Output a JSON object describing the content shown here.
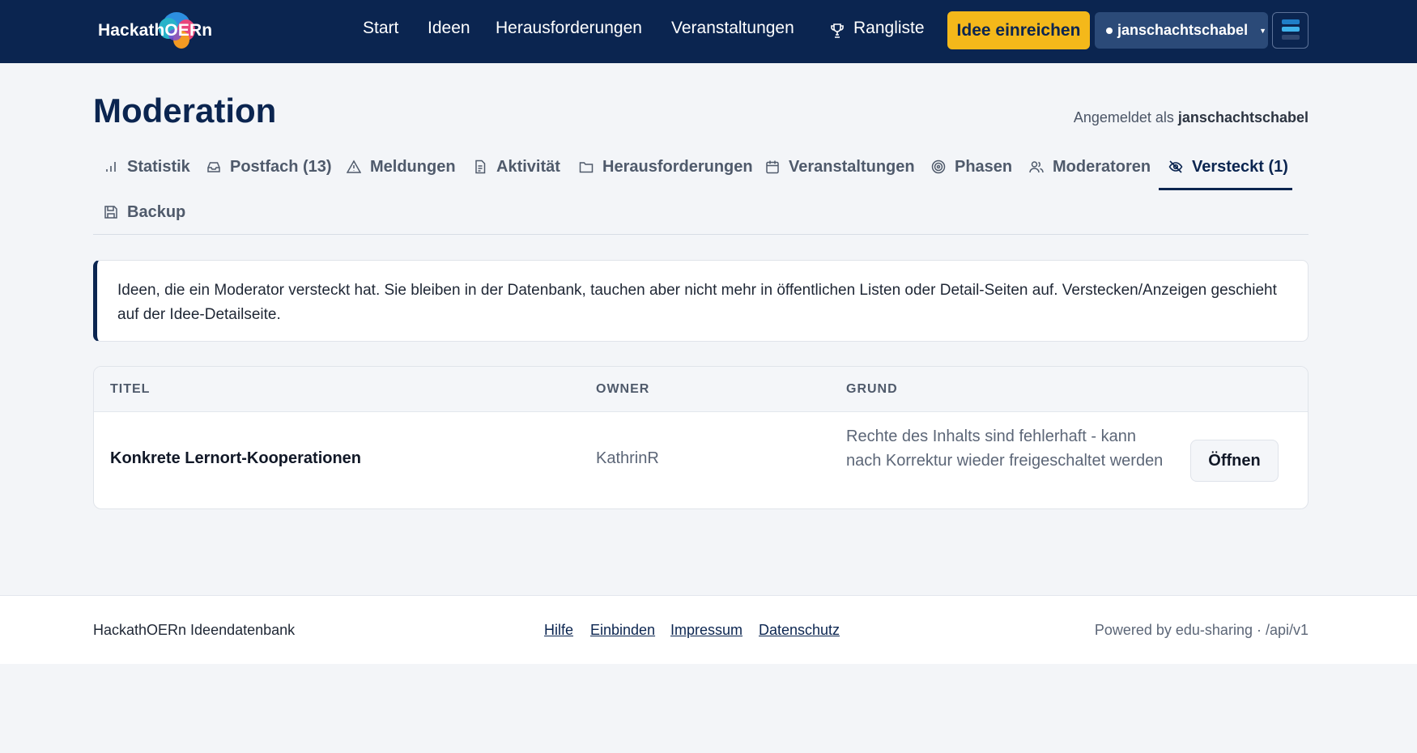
{
  "header": {
    "logo_text": "HackathOERn",
    "nav": [
      "Start",
      "Ideen",
      "Herausforderungen",
      "Veranstaltungen",
      "Rangliste"
    ],
    "submit_label": "Idee einreichen",
    "username": "janschachtschabel",
    "colors": {
      "bar": "#0b2550",
      "accent": "#f4b81a"
    }
  },
  "page": {
    "title": "Moderation",
    "logged_in_prefix": "Angemeldet als",
    "logged_in_user": "janschachtschabel"
  },
  "tabs": [
    {
      "label": "Statistik",
      "icon": "bar-chart-icon"
    },
    {
      "label": "Postfach (13)",
      "icon": "inbox-icon"
    },
    {
      "label": "Meldungen",
      "icon": "warning-icon"
    },
    {
      "label": "Aktivität",
      "icon": "document-icon"
    },
    {
      "label": "Herausforderungen",
      "icon": "folder-icon"
    },
    {
      "label": "Veranstaltungen",
      "icon": "calendar-icon"
    },
    {
      "label": "Phasen",
      "icon": "target-icon"
    },
    {
      "label": "Moderatoren",
      "icon": "users-icon"
    },
    {
      "label": "Versteckt (1)",
      "icon": "eye-off-icon",
      "active": true
    },
    {
      "label": "Backup",
      "icon": "save-icon"
    }
  ],
  "info_text": "Ideen, die ein Moderator versteckt hat. Sie bleiben in der Datenbank, tauchen aber nicht mehr in öffentlichen Listen oder Detail-Seiten auf. Verstecken/Anzeigen geschieht auf der Idee-Detailseite.",
  "table": {
    "columns": [
      "TITEL",
      "OWNER",
      "GRUND"
    ],
    "rows": [
      {
        "title": "Konkrete Lernort-Kooperationen",
        "owner": "KathrinR",
        "reason": "Rechte des Inhalts sind fehlerhaft - kann nach Korrektur wieder freigeschaltet werden",
        "action": "Öffnen"
      }
    ]
  },
  "footer": {
    "brand": "HackathOERn Ideendatenbank",
    "links": [
      "Hilfe",
      "Einbinden",
      "Impressum",
      "Datenschutz"
    ],
    "right": "Powered by edu-sharing · /api/v1"
  }
}
